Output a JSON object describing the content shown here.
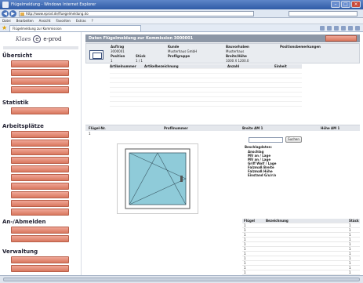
{
  "window": {
    "title": "Flügelmeldung - Windows Internet Explorer",
    "url": "http://www.eprod.de/fluegelmeldung.do",
    "search_placeholder": "",
    "menu": [
      "Datei",
      "Bearbeiten",
      "Ansicht",
      "Favoriten",
      "Extras",
      "?"
    ],
    "tab_title": "Flügelmeldung zur Kommission"
  },
  "sidebar": {
    "logo_left": "Klaes",
    "logo_mark": "e",
    "logo_right": "e-prod",
    "sections": [
      {
        "title": "Übersicht",
        "buttons": [
          "",
          "",
          "",
          ""
        ]
      },
      {
        "title": "Statistik",
        "buttons": [
          ""
        ]
      },
      {
        "title": "Arbeitsplätze",
        "buttons": [
          "",
          "",
          "",
          "",
          "",
          "",
          "",
          "",
          "",
          ""
        ]
      },
      {
        "title": "An-/Abmelden",
        "buttons": [
          "",
          ""
        ]
      },
      {
        "title": "Verwaltung",
        "buttons": [
          "",
          ""
        ]
      }
    ]
  },
  "header": {
    "title": "Daten Flügelmeldung zur Kommission 3000001",
    "button": ""
  },
  "order": {
    "labels": {
      "auftrag": "Auftrag",
      "kunde": "Kunde",
      "bauvorhaben": "Bauvorhaben",
      "position": "Position",
      "stueck": "Stück",
      "profilgruppe": "Profilgruppe",
      "breite_hoehe": "Breite/Höhe",
      "bemerkungen": "Positionsbemerkungen"
    },
    "values": {
      "auftrag": "3000001",
      "kunde": "Musterhaus GmbH",
      "bauvorhaben": "Musterhaus",
      "position": "1",
      "stueck": "1 / 1",
      "profilgruppe": "",
      "breite_hoehe": "1000 X 1200.0"
    }
  },
  "articles": {
    "headers": [
      "Artikelnummer",
      "Artikelbezeichnung",
      "Anzahl",
      "Einheit"
    ],
    "rows": [
      [
        "",
        "",
        "",
        ""
      ],
      [
        "",
        "",
        "",
        ""
      ],
      [
        "",
        "",
        "",
        ""
      ],
      [
        "",
        "",
        "",
        ""
      ],
      [
        "",
        "",
        "",
        ""
      ],
      [
        "",
        "",
        "",
        ""
      ],
      [
        "",
        "",
        "",
        ""
      ],
      [
        "",
        "",
        "",
        ""
      ]
    ]
  },
  "wing": {
    "headers": [
      "Flügel-Nr.",
      "Profilnummer",
      "Breite AM 1",
      "Höhe AM 1"
    ],
    "row": [
      "1",
      "",
      "",
      ""
    ]
  },
  "drawing_caption": "",
  "search_button": "Suchen",
  "props": {
    "title": "Beschlagdaten:",
    "rows": [
      {
        "k": "Anschlag",
        "v": ""
      },
      {
        "k": "MV an / Lage",
        "v": ""
      },
      {
        "k": "MV an / Lage",
        "v": ""
      },
      {
        "k": "Griff Wolf / Lage",
        "v": ""
      },
      {
        "k": "Falzmaß Breite",
        "v": ""
      },
      {
        "k": "Falzmaß Höhe",
        "v": ""
      },
      {
        "k": "Einstand G/u/r/o",
        "v": ""
      }
    ]
  },
  "parts": {
    "headers": [
      "Flügel",
      "Bezeichnung",
      "Stück"
    ],
    "rows": [
      [
        "1",
        "",
        "1"
      ],
      [
        "1",
        "",
        "1"
      ],
      [
        "1",
        "",
        "1"
      ],
      [
        "1",
        "",
        "1"
      ],
      [
        "1",
        "",
        "1"
      ],
      [
        "1",
        "",
        "1"
      ],
      [
        "1",
        "",
        "1"
      ],
      [
        "1",
        "",
        "1"
      ],
      [
        "1",
        "",
        "1"
      ],
      [
        "1",
        "",
        "1"
      ],
      [
        "1",
        "",
        "1"
      ],
      [
        "1",
        "",
        "1"
      ],
      [
        "1",
        "",
        "1"
      ],
      [
        "1",
        "",
        "1"
      ]
    ]
  },
  "colors": {
    "accent_button": "#d9785f",
    "header_bar": "#8d97a6",
    "glass": "#8fcbd9"
  }
}
